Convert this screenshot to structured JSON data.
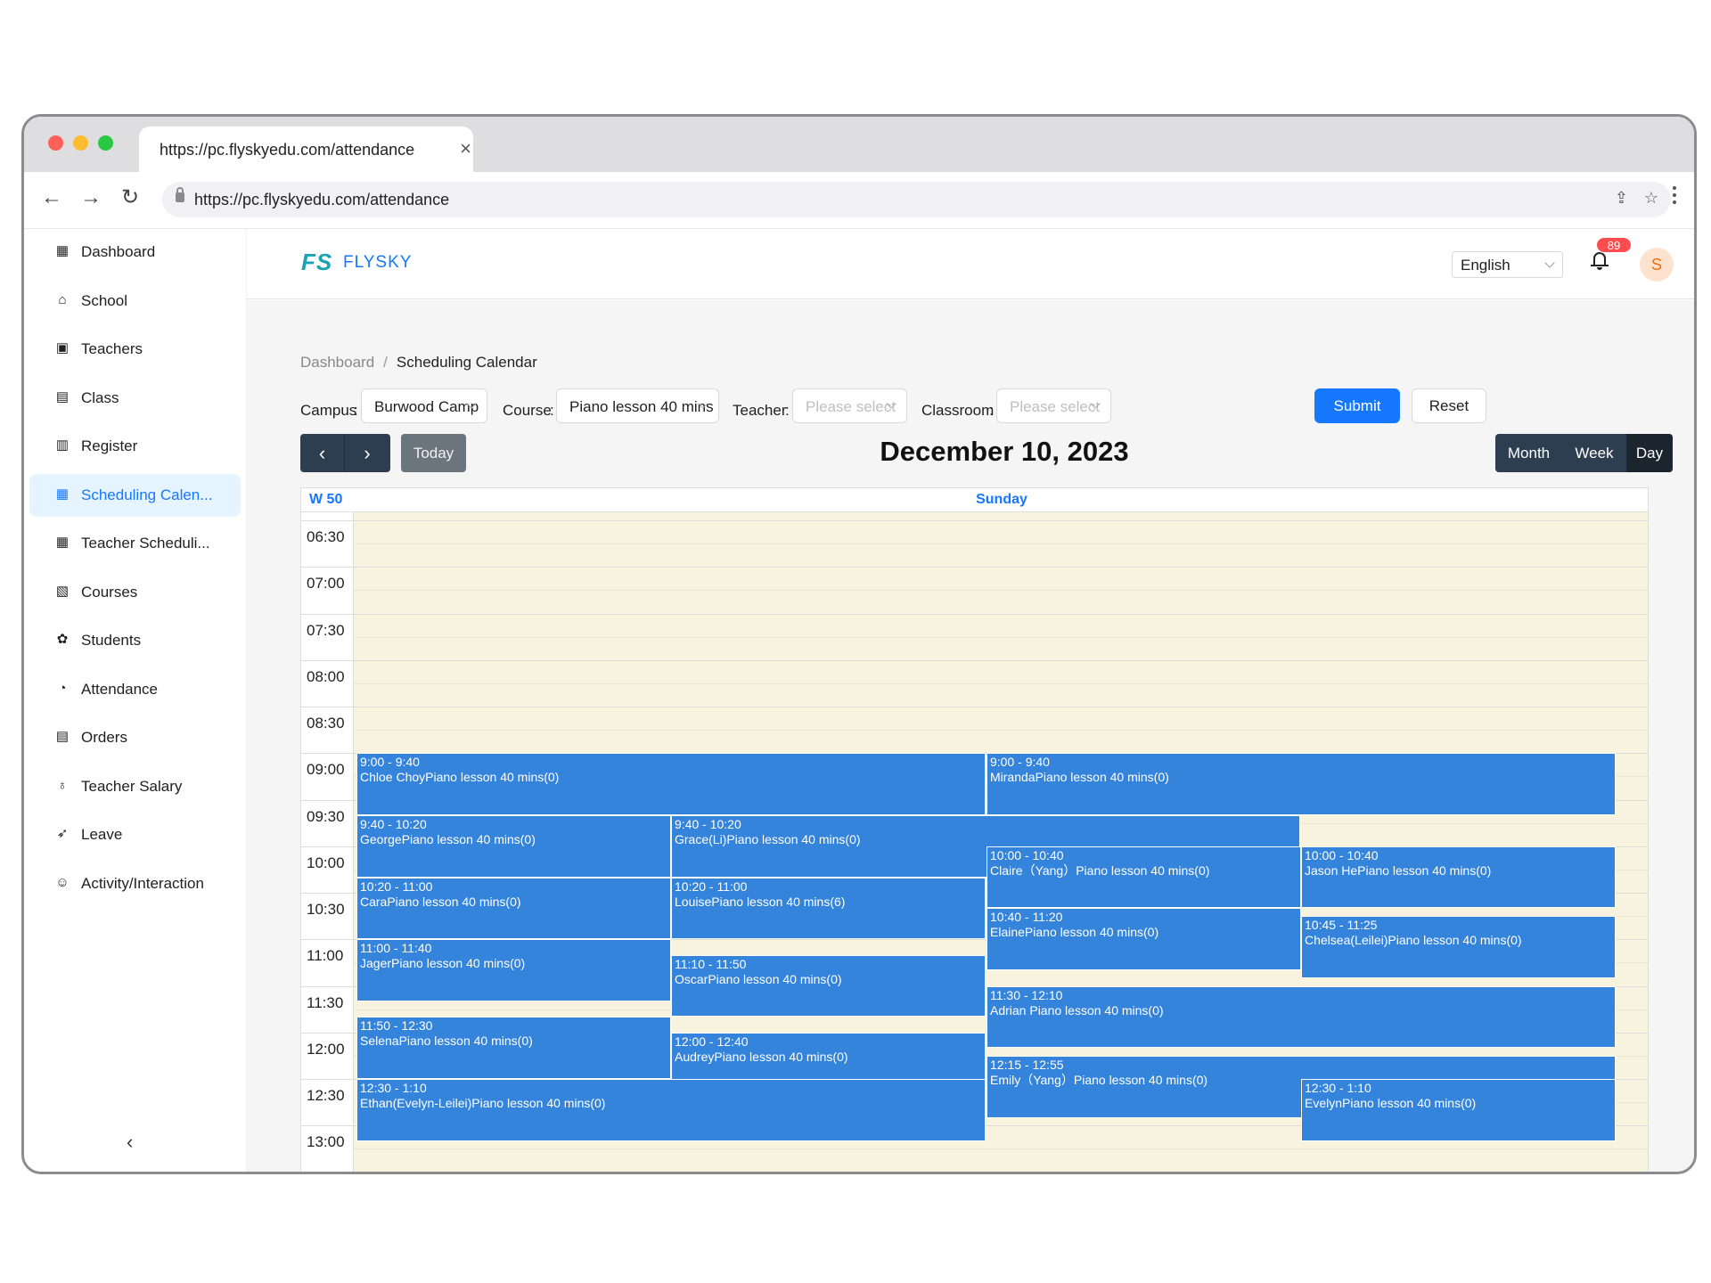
{
  "browser": {
    "tab_title": "https://pc.flyskyedu.com/attendance",
    "tab_close": "×",
    "url": "https://pc.flyskyedu.com/attendance",
    "icons": {
      "back": "arrow-left",
      "forward": "arrow-right",
      "reload": "reload",
      "share": "share",
      "star": "star"
    }
  },
  "sidebar": {
    "items": [
      {
        "label": "Dashboard",
        "icon": "dashboard-grid",
        "glyph": "▦"
      },
      {
        "label": "School",
        "icon": "school-building",
        "glyph": "⌂"
      },
      {
        "label": "Teachers",
        "icon": "id-card",
        "glyph": "▣"
      },
      {
        "label": "Class",
        "icon": "whiteboard",
        "glyph": "▤"
      },
      {
        "label": "Register",
        "icon": "clipboard-user",
        "glyph": "▥"
      },
      {
        "label": "Scheduling Calen...",
        "icon": "calendar",
        "glyph": "▦",
        "active": true
      },
      {
        "label": "Teacher Scheduli...",
        "icon": "calendar-check",
        "glyph": "▦"
      },
      {
        "label": "Courses",
        "icon": "book-open",
        "glyph": "▧"
      },
      {
        "label": "Students",
        "icon": "paw",
        "glyph": "✿"
      },
      {
        "label": "Attendance",
        "icon": "clock",
        "glyph": "◔"
      },
      {
        "label": "Orders",
        "icon": "receipt",
        "glyph": "▤"
      },
      {
        "label": "Teacher Salary",
        "icon": "money-bag",
        "glyph": "♁"
      },
      {
        "label": "Leave",
        "icon": "leaf",
        "glyph": "➶"
      },
      {
        "label": "Activity/Interaction",
        "icon": "activity-people",
        "glyph": "☺"
      }
    ],
    "collapse_glyph": "‹"
  },
  "header": {
    "logo_mark": "FS",
    "logo_text": "FLYSKY",
    "language": "English",
    "notification_count": "89",
    "avatar_letter": "S"
  },
  "breadcrumb": {
    "root": "Dashboard",
    "separator": "/",
    "current": "Scheduling Calendar"
  },
  "filters": {
    "campus": {
      "label": "Campus",
      "value": "Burwood Camp"
    },
    "course": {
      "label": "Course",
      "value": "Piano lesson 40 mins"
    },
    "teacher": {
      "label": "Teacher",
      "placeholder": "Please select"
    },
    "classroom": {
      "label": "Classroom",
      "placeholder": "Please select"
    },
    "submit_label": "Submit",
    "reset_label": "Reset"
  },
  "calendar": {
    "prev_glyph": "‹",
    "next_glyph": "›",
    "today_label": "Today",
    "title": "December 10, 2023",
    "views": {
      "month": "Month",
      "week": "Week",
      "day": "Day",
      "active": "day"
    },
    "week_label": "W 50",
    "day_label": "Sunday",
    "time_slots": [
      "06:30",
      "07:00",
      "07:30",
      "08:00",
      "08:30",
      "09:00",
      "09:30",
      "10:00",
      "10:30",
      "11:00",
      "11:30",
      "12:00",
      "12:30",
      "13:00"
    ],
    "event_color": "#3584db",
    "background_color": "#f8f3de",
    "accent_color": "#1677ff",
    "events": [
      {
        "time": "9:00 - 9:40",
        "title": "Chloe ChoyPiano lesson 40 mins(0)",
        "start": "9:00",
        "end": "9:40",
        "col": 0,
        "span": 2
      },
      {
        "time": "9:00 - 9:40",
        "title": "MirandaPiano lesson 40 mins(0)",
        "start": "9:00",
        "end": "9:40",
        "col": 2,
        "span": 2
      },
      {
        "time": "9:40 - 10:20",
        "title": "GeorgePiano lesson 40 mins(0)",
        "start": "9:40",
        "end": "10:20",
        "col": 0,
        "span": 1
      },
      {
        "time": "9:40 - 10:20",
        "title": "Grace(Li)Piano lesson 40 mins(0)",
        "start": "9:40",
        "end": "10:20",
        "col": 1,
        "span": 2
      },
      {
        "time": "10:00 - 10:40",
        "title": "Claire（Yang）Piano lesson 40 mins(0)",
        "start": "10:00",
        "end": "10:40",
        "col": 2,
        "span": 1
      },
      {
        "time": "10:00 - 10:40",
        "title": "Jason HePiano lesson 40 mins(0)",
        "start": "10:00",
        "end": "10:40",
        "col": 3,
        "span": 1
      },
      {
        "time": "10:20 - 11:00",
        "title": "CaraPiano lesson 40 mins(0)",
        "start": "10:20",
        "end": "11:00",
        "col": 0,
        "span": 1
      },
      {
        "time": "10:20 - 11:00",
        "title": "LouisePiano lesson 40 mins(6)",
        "start": "10:20",
        "end": "11:00",
        "col": 1,
        "span": 1
      },
      {
        "time": "10:40 - 11:20",
        "title": "ElainePiano lesson 40 mins(0)",
        "start": "10:40",
        "end": "11:20",
        "col": 2,
        "span": 1
      },
      {
        "time": "10:45 - 11:25",
        "title": "Chelsea(Leilei)Piano lesson 40 mins(0)",
        "start": "10:45",
        "end": "11:25",
        "col": 3,
        "span": 1
      },
      {
        "time": "11:00 - 11:40",
        "title": "JagerPiano lesson 40 mins(0)",
        "start": "11:00",
        "end": "11:40",
        "col": 0,
        "span": 1
      },
      {
        "time": "11:10 - 11:50",
        "title": "OscarPiano lesson 40 mins(0)",
        "start": "11:10",
        "end": "11:50",
        "col": 1,
        "span": 1
      },
      {
        "time": "11:30 - 12:10",
        "title": "Adrian Piano lesson 40 mins(0)",
        "start": "11:30",
        "end": "12:10",
        "col": 2,
        "span": 2
      },
      {
        "time": "11:50 - 12:30",
        "title": "SelenaPiano lesson 40 mins(0)",
        "start": "11:50",
        "end": "12:30",
        "col": 0,
        "span": 1
      },
      {
        "time": "12:00 - 12:40",
        "title": "AudreyPiano lesson 40 mins(0)",
        "start": "12:00",
        "end": "12:40",
        "col": 1,
        "span": 1
      },
      {
        "time": "12:15 - 12:55",
        "title": "Emily（Yang）Piano lesson 40 mins(0)",
        "start": "12:15",
        "end": "12:55",
        "col": 2,
        "span": 2
      },
      {
        "time": "12:30 - 1:10",
        "title": "Ethan(Evelyn-Leilei)Piano lesson 40 mins(0)",
        "start": "12:30",
        "end": "1:10",
        "col": 0,
        "span": 2
      },
      {
        "time": "12:30 - 1:10",
        "title": "EvelynPiano lesson 40 mins(0)",
        "start": "12:30",
        "end": "1:10",
        "col": 3,
        "span": 1
      }
    ]
  }
}
